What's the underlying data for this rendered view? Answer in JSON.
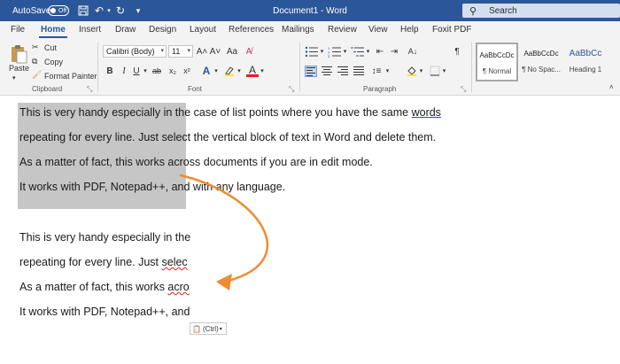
{
  "titlebar": {
    "autosave_label": "AutoSave",
    "autosave_state": "Off",
    "title": "Document1  -  Word",
    "search_placeholder": "Search"
  },
  "tabs": [
    "File",
    "Home",
    "Insert",
    "Draw",
    "Design",
    "Layout",
    "References",
    "Mailings",
    "Review",
    "View",
    "Help",
    "Foxit PDF"
  ],
  "active_tab": "Home",
  "ribbon": {
    "clipboard": {
      "paste": "Paste",
      "cut": "Cut",
      "copy": "Copy",
      "format_painter": "Format Painter",
      "label": "Clipboard"
    },
    "font": {
      "family": "Calibri (Body)",
      "size": "11",
      "label": "Font",
      "bold": "B",
      "italic": "I",
      "underline": "U",
      "strike": "ab",
      "subscript": "x₂",
      "superscript": "x²",
      "grow": "A˄",
      "shrink": "A˅",
      "case": "Aa",
      "text_effects": "A",
      "font_color": "A"
    },
    "paragraph": {
      "label": "Paragraph",
      "pilcrow": "¶"
    },
    "styles": [
      {
        "preview": "AaBbCcDc",
        "name": "¶ Normal"
      },
      {
        "preview": "AaBbCcDc",
        "name": "¶ No Spac..."
      },
      {
        "preview": "AaBbCc",
        "name": "Heading 1"
      }
    ]
  },
  "document": {
    "lines": [
      {
        "a": "This is very handy especially in the case of list points where you have the same ",
        "b": "words"
      },
      {
        "a": " repeating for every line. Just select the vertical block of text in Word and delete them."
      },
      {
        "a": "As a matter of fact, this works across documents if you are in edit mode."
      },
      {
        "a": "It works with PDF, Notepad++, and with any language."
      },
      {
        "a": "This is very handy especially in the"
      },
      {
        "a": " repeating for every line. Just ",
        "b": "selec"
      },
      {
        "a": "As a matter of fact, this works ",
        "b": "acro"
      },
      {
        "a": "It works with PDF, Notepad++, and"
      }
    ],
    "paste_options": "(Ctrl)",
    "arrow_color": "#f08b32"
  }
}
